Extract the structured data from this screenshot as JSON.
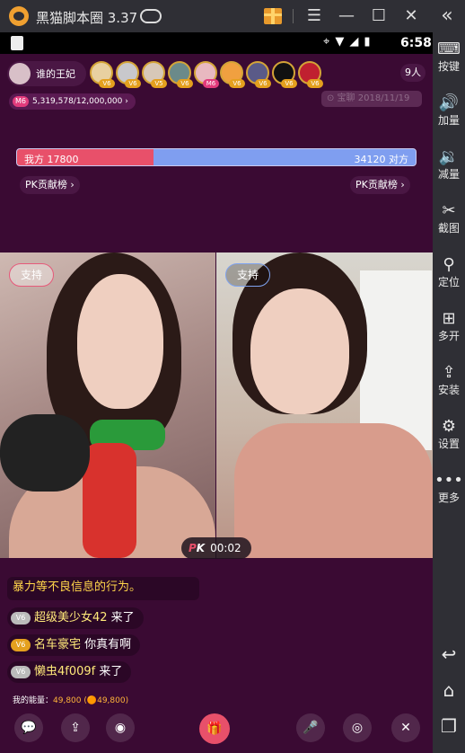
{
  "titlebar": {
    "app_title": "黑猫脚本圈 3.37",
    "menu_icon": "☰",
    "minimize_icon": "—",
    "maximize_icon": "☐",
    "close_icon": "✕",
    "collapse_icon": "«"
  },
  "statusbar": {
    "icons": "⌖▼◢▮",
    "time": "6:58"
  },
  "sidebar": {
    "items": [
      {
        "icon": "⌨",
        "label": "按键"
      },
      {
        "icon": "🔊",
        "label": "加量"
      },
      {
        "icon": "🔉",
        "label": "减量"
      },
      {
        "icon": "✂",
        "label": "截图"
      },
      {
        "icon": "⚲",
        "label": "定位"
      },
      {
        "icon": "⊞",
        "label": "多开"
      },
      {
        "icon": "⇪",
        "label": "安装"
      },
      {
        "icon": "⚙",
        "label": "设置"
      },
      {
        "icon": "•••",
        "label": "更多"
      }
    ],
    "back_icon": "↩",
    "home_icon": "⌂",
    "recents_icon": "❐"
  },
  "live": {
    "host_name": "谁的王妃",
    "viewer_badges": [
      "V6",
      "V6",
      "V5",
      "V6",
      "M6",
      "V6",
      "V6",
      "V6",
      "V6"
    ],
    "viewer_count": "9人",
    "contribution_level": "M6",
    "contribution": "5,319,578/12,000,000",
    "contribution_arrow": "›",
    "watermark": "⊙ 宝聊 2018/11/19"
  },
  "pk": {
    "left_label": "我方",
    "left_score": 17800,
    "right_label": "对方",
    "right_score": 34120,
    "left_rank": "PK贡献榜",
    "right_rank": "PK贡献榜",
    "rank_arrow": "›",
    "support_left": "支持",
    "support_right": "支持",
    "timer_logo_p": "P",
    "timer_logo_k": "K",
    "timer": "00:02"
  },
  "chat": {
    "system_message": "暴力等不良信息的行为。",
    "messages": [
      {
        "badge": "V6",
        "gold": false,
        "user": "超级美少女42",
        "text": " 来了"
      },
      {
        "badge": "V6",
        "gold": true,
        "user": "名车豪宅",
        "text": " 你真有啊"
      },
      {
        "badge": "V6",
        "gold": false,
        "user": "懒虫4f009f",
        "text": " 来了"
      }
    ]
  },
  "energy": {
    "label": "我的能量：",
    "value": "49,800",
    "coins": "(🟠49,800)"
  },
  "toolbar": {
    "chat_icon": "💬",
    "share_icon": "⇪",
    "camera_icon": "◉",
    "gift_icon": "🎁",
    "mic_icon": "🎤",
    "beauty_icon": "◎",
    "close_icon": "✕"
  }
}
